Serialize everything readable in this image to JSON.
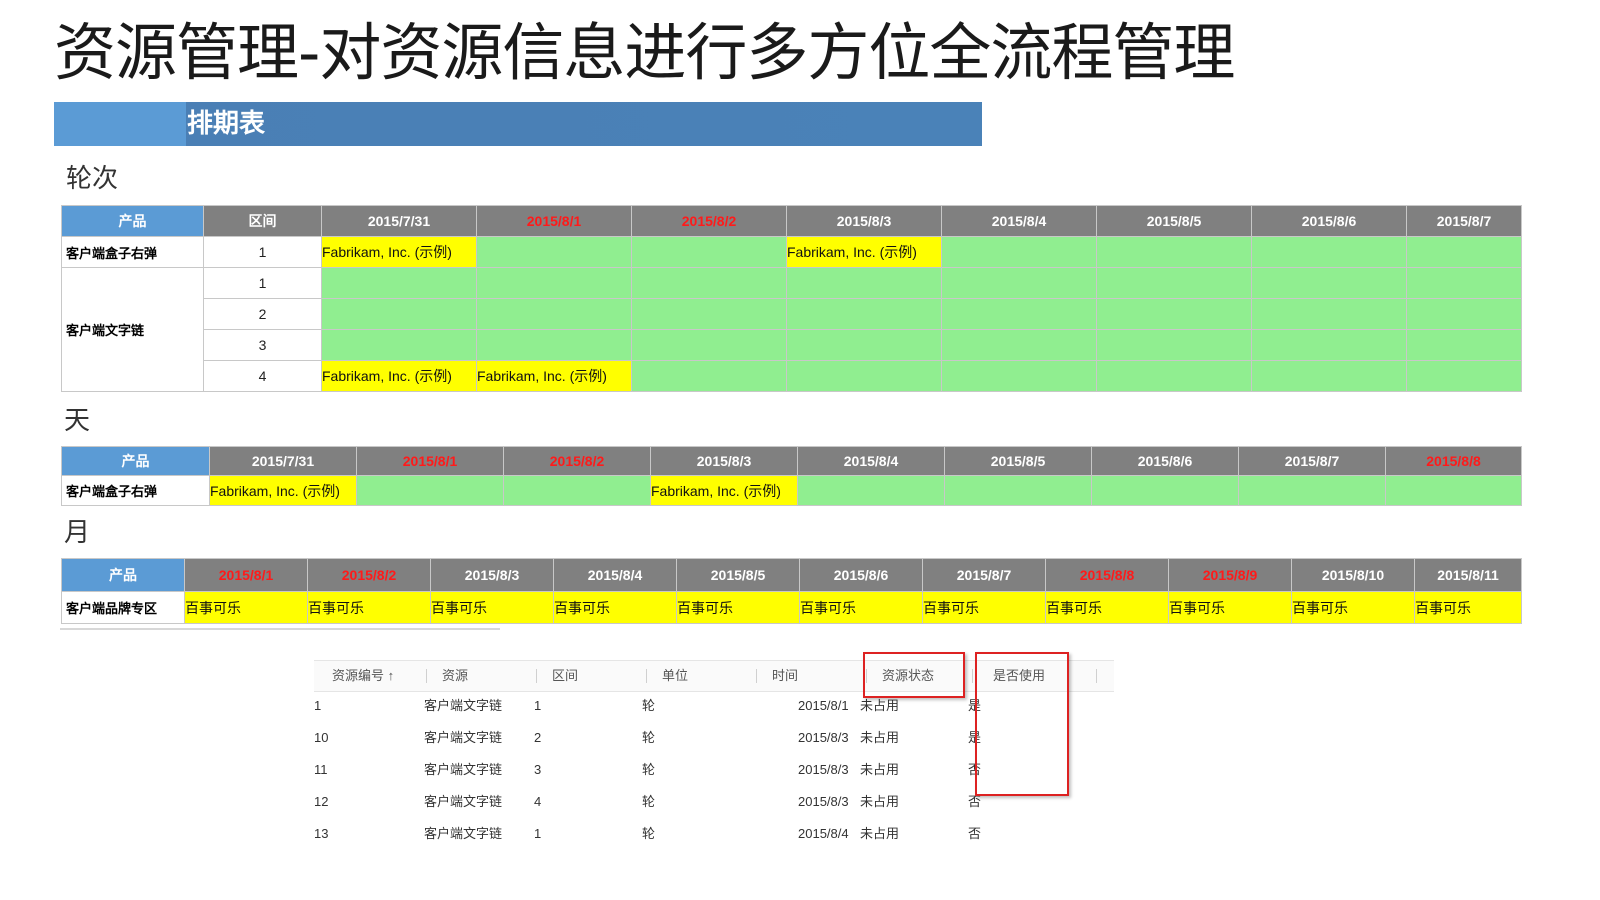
{
  "title": "资源管理-对资源信息进行多方位全流程管理",
  "banner": "排期表",
  "colors": {
    "product_header": "#5b9bd5",
    "date_header": "#808080",
    "weekend_date": "#ff1a1a",
    "free": "#90ee90",
    "booked": "#ffff00",
    "highlight_box": "#dd2222"
  },
  "round": {
    "label": "轮次",
    "head_product": "产品",
    "head_range": "区间",
    "dates": [
      {
        "text": "2015/7/31",
        "red": false
      },
      {
        "text": "2015/8/1",
        "red": true
      },
      {
        "text": "2015/8/2",
        "red": true
      },
      {
        "text": "2015/8/3",
        "red": false
      },
      {
        "text": "2015/8/4",
        "red": false
      },
      {
        "text": "2015/8/5",
        "red": false
      },
      {
        "text": "2015/8/6",
        "red": false
      },
      {
        "text": "2015/8/7",
        "red": false
      }
    ],
    "rows": [
      {
        "product": "客户端盒子右弹",
        "range": "1",
        "cells": [
          "Fabrikam, Inc. (示例)",
          "",
          "",
          "Fabrikam, Inc. (示例)",
          "",
          "",
          "",
          ""
        ]
      },
      {
        "product": "客户端文字链",
        "range": "1",
        "cells": [
          "",
          "",
          "",
          "",
          "",
          "",
          "",
          ""
        ]
      },
      {
        "product": "",
        "range": "2",
        "cells": [
          "",
          "",
          "",
          "",
          "",
          "",
          "",
          ""
        ]
      },
      {
        "product": "",
        "range": "3",
        "cells": [
          "",
          "",
          "",
          "",
          "",
          "",
          "",
          ""
        ]
      },
      {
        "product": "",
        "range": "4",
        "cells": [
          "Fabrikam, Inc. (示例)",
          "Fabrikam, Inc. (示例)",
          "",
          "",
          "",
          "",
          "",
          ""
        ]
      }
    ]
  },
  "day": {
    "label": "天",
    "head_product": "产品",
    "dates": [
      {
        "text": "2015/7/31",
        "red": false
      },
      {
        "text": "2015/8/1",
        "red": true
      },
      {
        "text": "2015/8/2",
        "red": true
      },
      {
        "text": "2015/8/3",
        "red": false
      },
      {
        "text": "2015/8/4",
        "red": false
      },
      {
        "text": "2015/8/5",
        "red": false
      },
      {
        "text": "2015/8/6",
        "red": false
      },
      {
        "text": "2015/8/7",
        "red": false
      },
      {
        "text": "2015/8/8",
        "red": true
      }
    ],
    "rows": [
      {
        "product": "客户端盒子右弹",
        "cells": [
          "Fabrikam, Inc. (示例)",
          "",
          "",
          "Fabrikam, Inc. (示例)",
          "",
          "",
          "",
          "",
          ""
        ]
      }
    ]
  },
  "month": {
    "label": "月",
    "head_product": "产品",
    "dates": [
      {
        "text": "2015/8/1",
        "red": true
      },
      {
        "text": "2015/8/2",
        "red": true
      },
      {
        "text": "2015/8/3",
        "red": false
      },
      {
        "text": "2015/8/4",
        "red": false
      },
      {
        "text": "2015/8/5",
        "red": false
      },
      {
        "text": "2015/8/6",
        "red": false
      },
      {
        "text": "2015/8/7",
        "red": false
      },
      {
        "text": "2015/8/8",
        "red": true
      },
      {
        "text": "2015/8/9",
        "red": true
      },
      {
        "text": "2015/8/10",
        "red": false
      },
      {
        "text": "2015/8/11",
        "red": false
      }
    ],
    "rows": [
      {
        "product": "客户端品牌专区",
        "cells": [
          "百事可乐",
          "百事可乐",
          "百事可乐",
          "百事可乐",
          "百事可乐",
          "百事可乐",
          "百事可乐",
          "百事可乐",
          "百事可乐",
          "百事可乐",
          "百事可乐"
        ]
      }
    ]
  },
  "list": {
    "headers": [
      "资源编号 ↑",
      "资源",
      "区间",
      "单位",
      "时间",
      "资源状态",
      "是否使用"
    ],
    "rows": [
      [
        "1",
        "客户端文字链",
        "1",
        "轮",
        "2015/8/1",
        "未占用",
        "是"
      ],
      [
        "10",
        "客户端文字链",
        "2",
        "轮",
        "2015/8/3",
        "未占用",
        "是"
      ],
      [
        "11",
        "客户端文字链",
        "3",
        "轮",
        "2015/8/3",
        "未占用",
        "否"
      ],
      [
        "12",
        "客户端文字链",
        "4",
        "轮",
        "2015/8/3",
        "未占用",
        "否"
      ],
      [
        "13",
        "客户端文字链",
        "1",
        "轮",
        "2015/8/4",
        "未占用",
        "否"
      ]
    ]
  }
}
